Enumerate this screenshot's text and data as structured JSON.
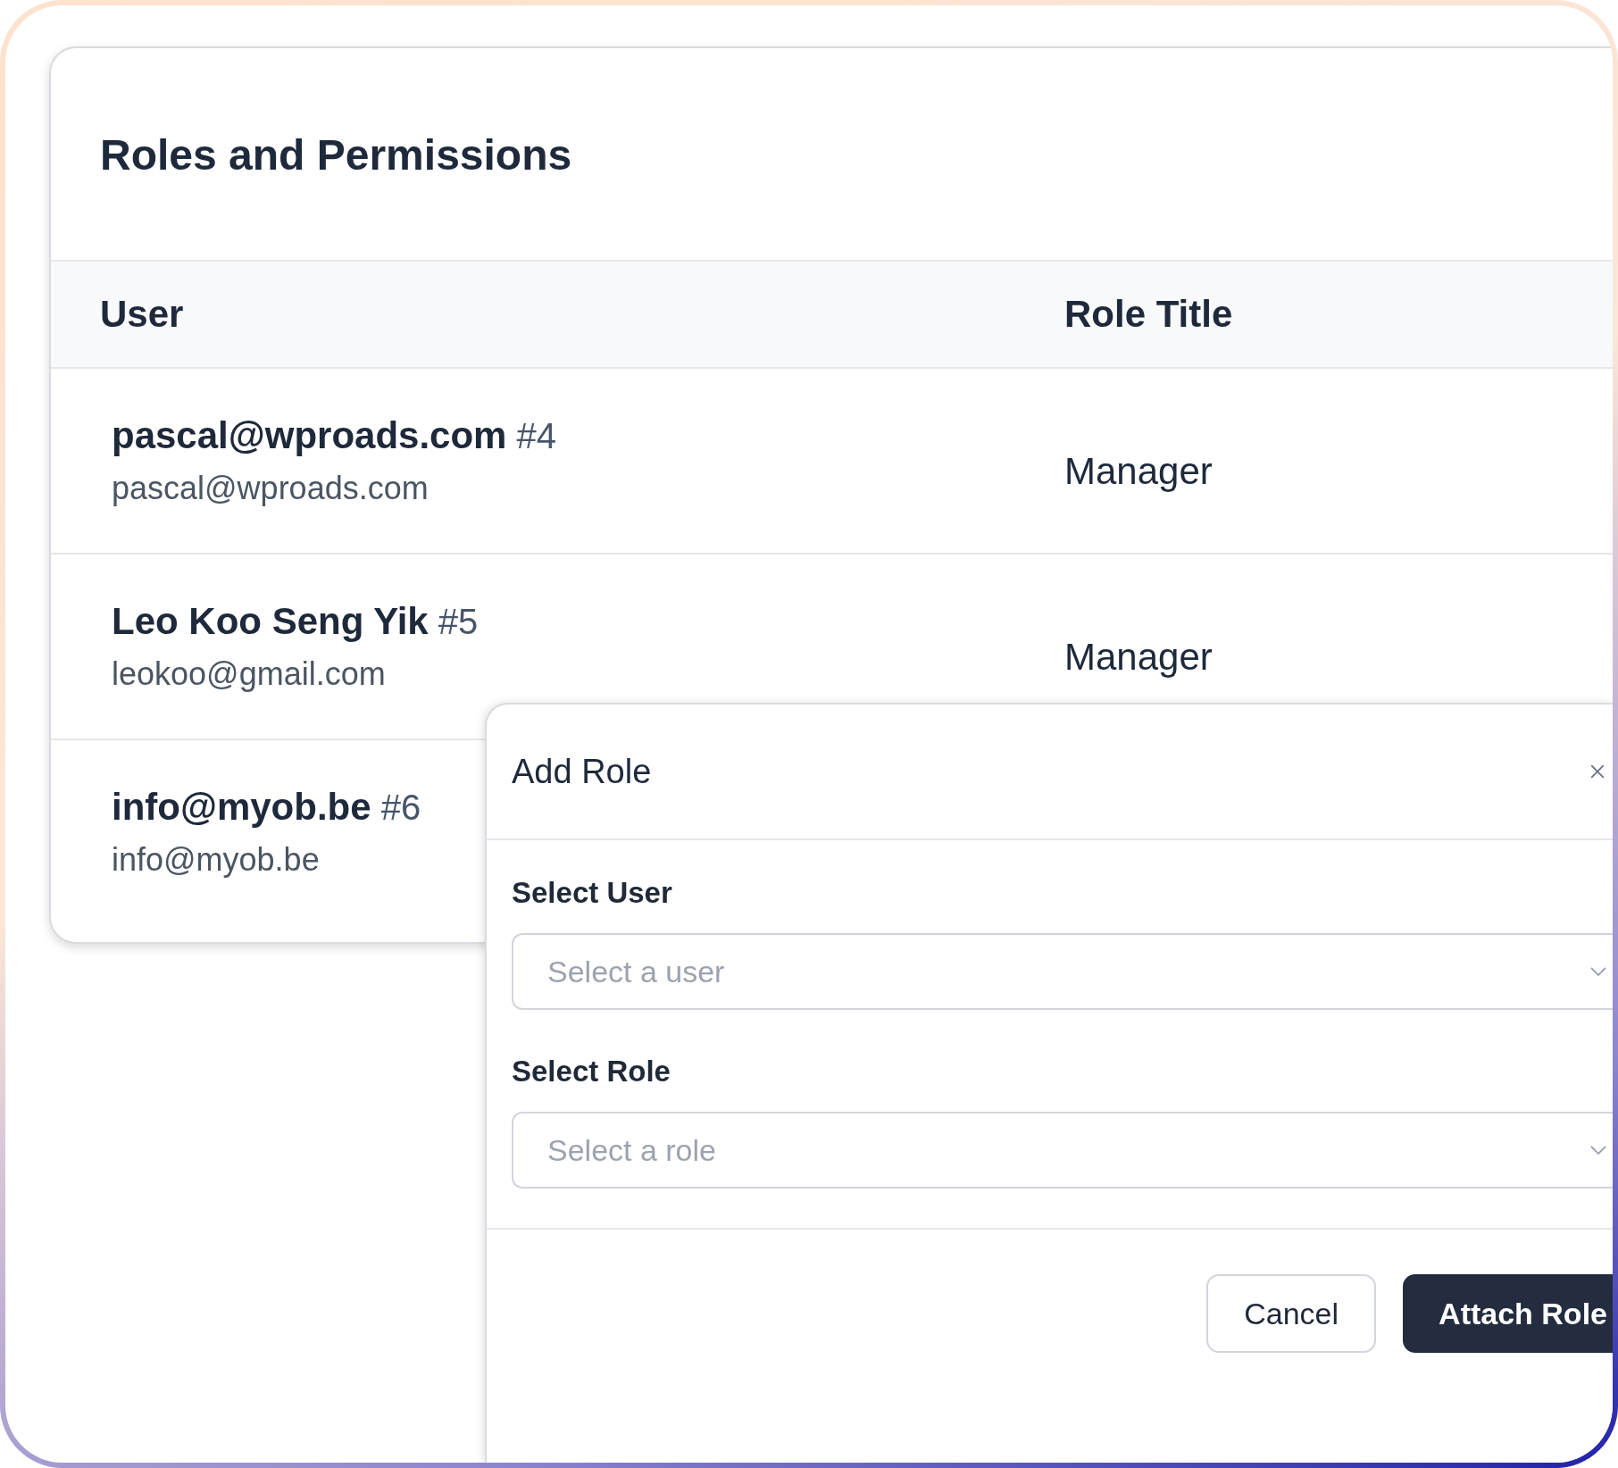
{
  "page": {
    "title": "Roles and Permissions"
  },
  "table": {
    "columns": [
      "User",
      "Role Title"
    ],
    "rows": [
      {
        "name": "**pascal@wproads.com** #4",
        "email": "pascal@wproads.com",
        "role": "Manager"
      },
      {
        "name": "**Leo Koo Seng Yik** #5",
        "email": "leokoo@gmail.com",
        "role": "Manager"
      },
      {
        "name": "**info@myob.be** #6",
        "email": "info@myob.be"
      }
    ]
  },
  "modal": {
    "title": "Add Role",
    "fields": [
      {
        "label": "Select User",
        "placeholder": "Select a user"
      },
      {
        "label": "Select Role",
        "placeholder": "Select a role"
      }
    ],
    "buttons": [
      {
        "label": "Cancel",
        "kind": "secondary"
      },
      {
        "label": "Attach Role",
        "kind": "primary"
      }
    ]
  }
}
